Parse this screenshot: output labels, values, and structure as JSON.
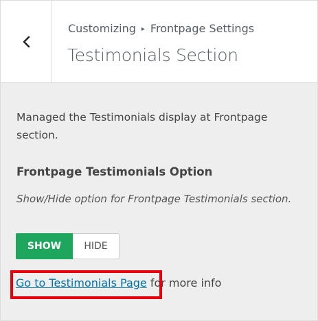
{
  "header": {
    "breadcrumb_parent": "Customizing",
    "breadcrumb_separator": "▸",
    "breadcrumb_child": "Frontpage Settings",
    "title": "Testimonials Section",
    "back_icon": "chevron-left-icon"
  },
  "content": {
    "description": "Managed the Testimonials display at Frontpage section.",
    "option_title": "Frontpage Testimonials Option",
    "option_description": "Show/Hide option for Frontpage Testimonials section.",
    "toggle": {
      "show_label": "SHOW",
      "hide_label": "HIDE",
      "selected": "SHOW",
      "active_color": "#1ea65d"
    },
    "link_text": "Go to Testimonials Page",
    "link_suffix": " for more info",
    "link_color": "#0073aa",
    "highlight_color": "#e8000b"
  }
}
